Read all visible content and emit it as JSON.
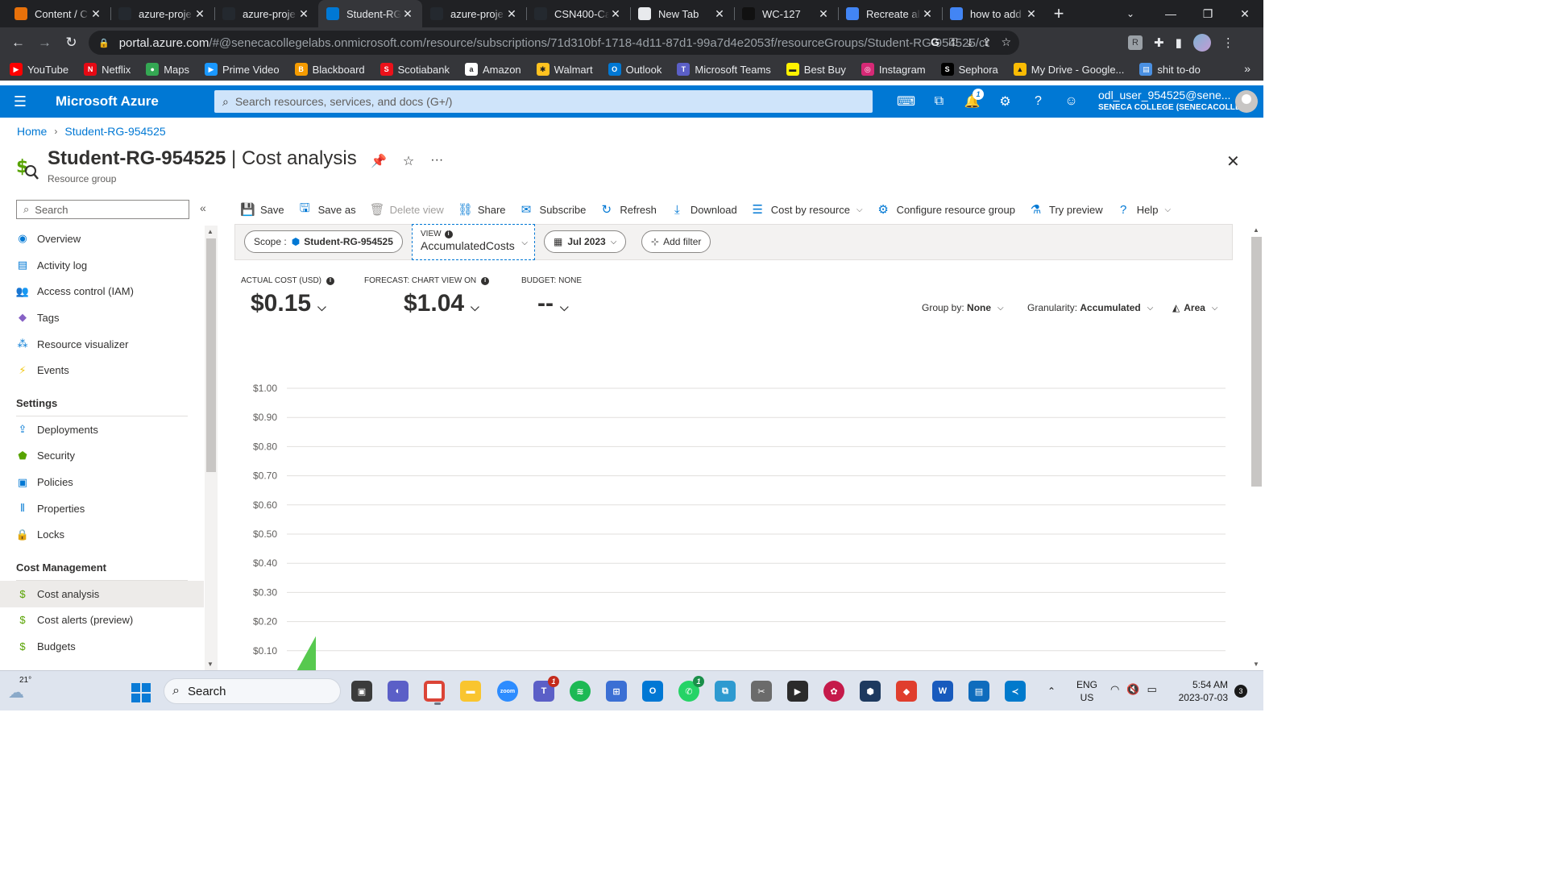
{
  "browser": {
    "tabs": [
      {
        "title": "Content / C",
        "icon": "document-icon",
        "color": "#e8710a",
        "active": false
      },
      {
        "title": "azure-proje",
        "icon": "github-icon",
        "color": "#24292f",
        "active": false
      },
      {
        "title": "azure-proje",
        "icon": "github-icon",
        "color": "#24292f",
        "active": false
      },
      {
        "title": "Student-RG",
        "icon": "azure-icon",
        "color": "#0078d4",
        "active": true
      },
      {
        "title": "azure-proje",
        "icon": "github-icon",
        "color": "#24292f",
        "active": false
      },
      {
        "title": "CSN400-Ca",
        "icon": "github-icon",
        "color": "#24292f",
        "active": false
      },
      {
        "title": "New Tab",
        "icon": "chrome-icon",
        "color": "#e8eaed",
        "active": false
      },
      {
        "title": "WC-127",
        "icon": "dark-icon",
        "color": "#111111",
        "active": false
      },
      {
        "title": "Recreate al",
        "icon": "google-icon",
        "color": "#4285f4",
        "active": false
      },
      {
        "title": "how to add",
        "icon": "google-icon",
        "color": "#4285f4",
        "active": false
      }
    ],
    "url_host": "portal.azure.com",
    "url_path": "/#@senecacollegelabs.onmicrosoft.com/resource/subscriptions/71d310bf-1718-4d11-87d1-99a7d4e2053f/resourceGroups/Student-RG-954525/costanal...",
    "bookmarks": [
      {
        "label": "YouTube",
        "color": "#ff0000",
        "glyph": "▶"
      },
      {
        "label": "Netflix",
        "color": "#e50914",
        "glyph": "N"
      },
      {
        "label": "Maps",
        "color": "#34a853",
        "glyph": "●"
      },
      {
        "label": "Prime Video",
        "color": "#1a98ff",
        "glyph": "▶"
      },
      {
        "label": "Blackboard",
        "color": "#f59b00",
        "glyph": "B"
      },
      {
        "label": "Scotiabank",
        "color": "#ec111a",
        "glyph": "S"
      },
      {
        "label": "Amazon",
        "color": "#ffffff",
        "glyph": "a"
      },
      {
        "label": "Walmart",
        "color": "#ffc220",
        "glyph": "✱"
      },
      {
        "label": "Outlook",
        "color": "#0078d4",
        "glyph": "O"
      },
      {
        "label": "Microsoft Teams",
        "color": "#5b5fc7",
        "glyph": "T"
      },
      {
        "label": "Best Buy",
        "color": "#fff200",
        "glyph": "▬"
      },
      {
        "label": "Instagram",
        "color": "#d62976",
        "glyph": "◎"
      },
      {
        "label": "Sephora",
        "color": "#000000",
        "glyph": "S"
      },
      {
        "label": "My Drive - Google...",
        "color": "#fbbc04",
        "glyph": "▲"
      },
      {
        "label": "shit to-do",
        "color": "#4a90e2",
        "glyph": "▤"
      }
    ]
  },
  "azure": {
    "brand": "Microsoft Azure",
    "search_placeholder": "Search resources, services, and docs (G+/)",
    "notification_count": "1",
    "account_user": "odl_user_954525@sene...",
    "account_org": "SENECA COLLEGE (SENECACOLLE..."
  },
  "breadcrumb": {
    "home": "Home",
    "current": "Student-RG-954525"
  },
  "page": {
    "title_main": "Student-RG-954525",
    "title_sep": " | ",
    "title_sub": "Cost analysis",
    "subtitle": "Resource group"
  },
  "leftnav": {
    "search_placeholder": "Search",
    "items_top": [
      {
        "label": "Overview",
        "icon": "overview-icon",
        "glyph": "◉",
        "color": "#0078d4"
      },
      {
        "label": "Activity log",
        "icon": "activity-log-icon",
        "glyph": "▤",
        "color": "#0078d4"
      },
      {
        "label": "Access control (IAM)",
        "icon": "iam-icon",
        "glyph": "👥",
        "color": "#0078d4"
      },
      {
        "label": "Tags",
        "icon": "tag-icon",
        "glyph": "◆",
        "color": "#8661c5"
      },
      {
        "label": "Resource visualizer",
        "icon": "visualizer-icon",
        "glyph": "⁂",
        "color": "#0078d4"
      },
      {
        "label": "Events",
        "icon": "events-icon",
        "glyph": "⚡",
        "color": "#f2c811"
      }
    ],
    "settings_header": "Settings",
    "items_settings": [
      {
        "label": "Deployments",
        "icon": "deployments-icon",
        "glyph": "⇪",
        "color": "#0078d4"
      },
      {
        "label": "Security",
        "icon": "shield-icon",
        "glyph": "⬟",
        "color": "#57a300"
      },
      {
        "label": "Policies",
        "icon": "policies-icon",
        "glyph": "▣",
        "color": "#0078d4"
      },
      {
        "label": "Properties",
        "icon": "properties-icon",
        "glyph": "⦀",
        "color": "#0078d4"
      },
      {
        "label": "Locks",
        "icon": "lock-icon",
        "glyph": "🔒",
        "color": "#0078d4"
      }
    ],
    "cost_header": "Cost Management",
    "items_cost": [
      {
        "label": "Cost analysis",
        "icon": "cost-analysis-icon",
        "glyph": "$",
        "color": "#57a300",
        "active": true
      },
      {
        "label": "Cost alerts (preview)",
        "icon": "cost-alerts-icon",
        "glyph": "$",
        "color": "#57a300"
      },
      {
        "label": "Budgets",
        "icon": "budgets-icon",
        "glyph": "$",
        "color": "#57a300"
      }
    ]
  },
  "commands": [
    {
      "label": "Save",
      "icon": "save-icon",
      "glyph": "💾",
      "disabled": false
    },
    {
      "label": "Save as",
      "icon": "save-as-icon",
      "glyph": "🖫",
      "disabled": false
    },
    {
      "label": "Delete view",
      "icon": "delete-icon",
      "glyph": "🗑",
      "disabled": true
    },
    {
      "label": "Share",
      "icon": "share-icon",
      "glyph": "⛓",
      "disabled": false
    },
    {
      "label": "Subscribe",
      "icon": "subscribe-icon",
      "glyph": "✉",
      "disabled": false
    },
    {
      "label": "Refresh",
      "icon": "refresh-icon",
      "glyph": "↻",
      "disabled": false
    },
    {
      "label": "Download",
      "icon": "download-icon",
      "glyph": "⤓",
      "disabled": false
    },
    {
      "label": "Cost by resource",
      "icon": "cost-by-resource-icon",
      "glyph": "☰",
      "disabled": false,
      "dropdown": true
    },
    {
      "label": "Configure resource group",
      "icon": "gear-icon",
      "glyph": "⚙",
      "disabled": false
    },
    {
      "label": "Try preview",
      "icon": "flask-icon",
      "glyph": "⚗",
      "disabled": false
    },
    {
      "label": "Help",
      "icon": "help-icon",
      "glyph": "?",
      "disabled": false,
      "dropdown": true
    }
  ],
  "filters": {
    "scope_label": "Scope :",
    "scope_value": "Student-RG-954525",
    "view_label": "VIEW",
    "view_value": "AccumulatedCosts",
    "date_value": "Jul 2023",
    "add_filter": "Add filter"
  },
  "kpis": {
    "actual_label": "ACTUAL COST (USD)",
    "actual_value": "$0.15",
    "forecast_label": "FORECAST: CHART VIEW ON",
    "forecast_value": "$1.04",
    "budget_label": "BUDGET: NONE",
    "budget_value": "--"
  },
  "chart_controls": {
    "group_by_label": "Group by:",
    "group_by_value": "None",
    "granularity_label": "Granularity:",
    "granularity_value": "Accumulated",
    "chart_type_value": "Area"
  },
  "chart_data": {
    "type": "area",
    "title": "",
    "xlabel": "",
    "ylabel": "",
    "ylim": [
      0.1,
      1.0
    ],
    "y_ticks": [
      "$1.00",
      "$0.90",
      "$0.80",
      "$0.70",
      "$0.60",
      "$0.50",
      "$0.40",
      "$0.30",
      "$0.20",
      "$0.10"
    ],
    "y_tick_values": [
      1.0,
      0.9,
      0.8,
      0.7,
      0.6,
      0.5,
      0.4,
      0.3,
      0.2,
      0.1
    ],
    "grid": true,
    "series": [
      {
        "values": [
          0.0,
          0.15
        ],
        "color": "#57c94f"
      }
    ]
  },
  "taskbar": {
    "temperature": "21°",
    "search_label": "Search",
    "lang_line1": "ENG",
    "lang_line2": "US",
    "time": "5:54 AM",
    "date": "2023-07-03",
    "notification_count": "3",
    "teams_badge": "1",
    "whatsapp_badge": "1"
  }
}
